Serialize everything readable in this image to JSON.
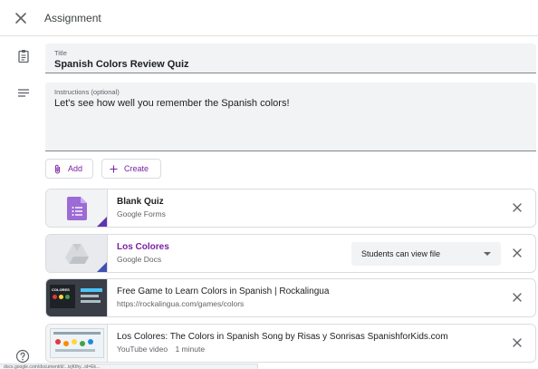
{
  "header": {
    "title": "Assignment"
  },
  "form": {
    "title_label": "Title",
    "title_value": "Spanish Colors Review Quiz",
    "instructions_label": "Instructions (optional)",
    "instructions_value": "Let's see how well you remember the Spanish colors!"
  },
  "buttons": {
    "add_label": "Add",
    "create_label": "Create"
  },
  "attachments": [
    {
      "title": "Blank Quiz",
      "subtitle": "Google Forms",
      "icon": "google-forms-icon"
    },
    {
      "title": "Los Colores",
      "subtitle": "Google Docs",
      "icon": "google-drive-icon",
      "permission": "Students can view file"
    },
    {
      "title": "Free Game to Learn Colors in Spanish | Rockalingua",
      "subtitle": "https://rockalingua.com/games/colors"
    },
    {
      "title": "Los Colores: The Colors in Spanish Song by Risas y Sonrisas SpanishforKids.com",
      "subtitle": "YouTube video",
      "duration": "1 minute"
    }
  ],
  "thumb_text": {
    "game_badge": "COLORES"
  },
  "statusbar": {
    "url": "docs.google.com/document/d/...ixjKthy...id=Ek..."
  },
  "colors": {
    "accent": "#7b1fa2",
    "forms_purple": "#9c6bd6",
    "corner": "#5e35b1"
  }
}
